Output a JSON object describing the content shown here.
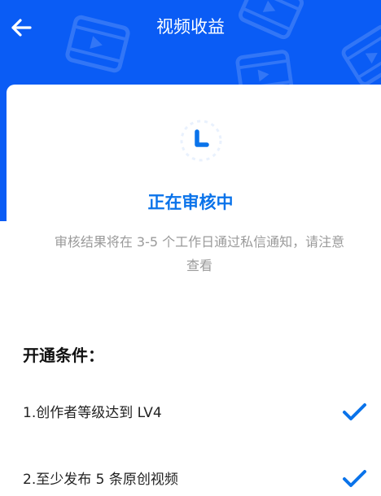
{
  "header": {
    "title": "视频收益",
    "back_icon": "arrow-left-icon",
    "background_color": "#0a5cf5"
  },
  "status": {
    "icon": "reviewing-hourglass-icon",
    "title": "正在审核中",
    "description": "审核结果将在 3-5 个工作日通过私信通知，请注意查看",
    "accent_color": "#0a73ea"
  },
  "conditions": {
    "heading": "开通条件：",
    "items": [
      {
        "text": "1.创作者等级达到 LV4",
        "met": true,
        "icon": "checkmark-icon"
      },
      {
        "text": "2.至少发布 5 条原创视频",
        "met": true,
        "icon": "checkmark-icon"
      }
    ]
  }
}
